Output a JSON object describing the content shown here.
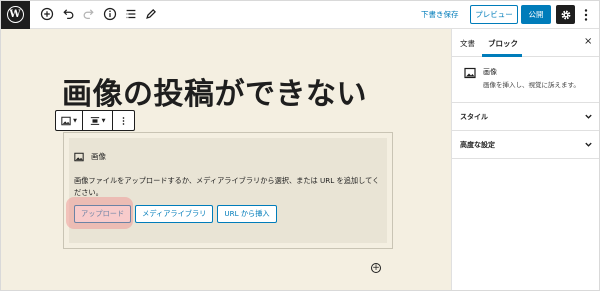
{
  "topbar": {
    "logo_letter": "W",
    "save_draft": "下書き保存",
    "preview": "プレビュー",
    "publish": "公開"
  },
  "editor": {
    "post_title": "画像の投稿ができない",
    "image_block": {
      "label": "画像",
      "instructions": "画像ファイルをアップロードするか、メディアライブラリから選択、または URL を追加してください。",
      "buttons": {
        "upload": "アップロード",
        "media_library": "メディアライブラリ",
        "insert_url": "URL から挿入"
      }
    },
    "add_block": "+"
  },
  "sidebar": {
    "tabs": {
      "document": "文書",
      "block": "ブロック"
    },
    "close": "×",
    "block_card": {
      "title": "画像",
      "description": "画像を挿入し、視覚に訴えます。"
    },
    "panels": {
      "style": "スタイル",
      "advanced": "高度な設定"
    }
  },
  "colors": {
    "accent": "#007cba",
    "canvas_bg": "#f4efe1",
    "highlight": "#f08c8c",
    "dark": "#1e1e1e"
  }
}
